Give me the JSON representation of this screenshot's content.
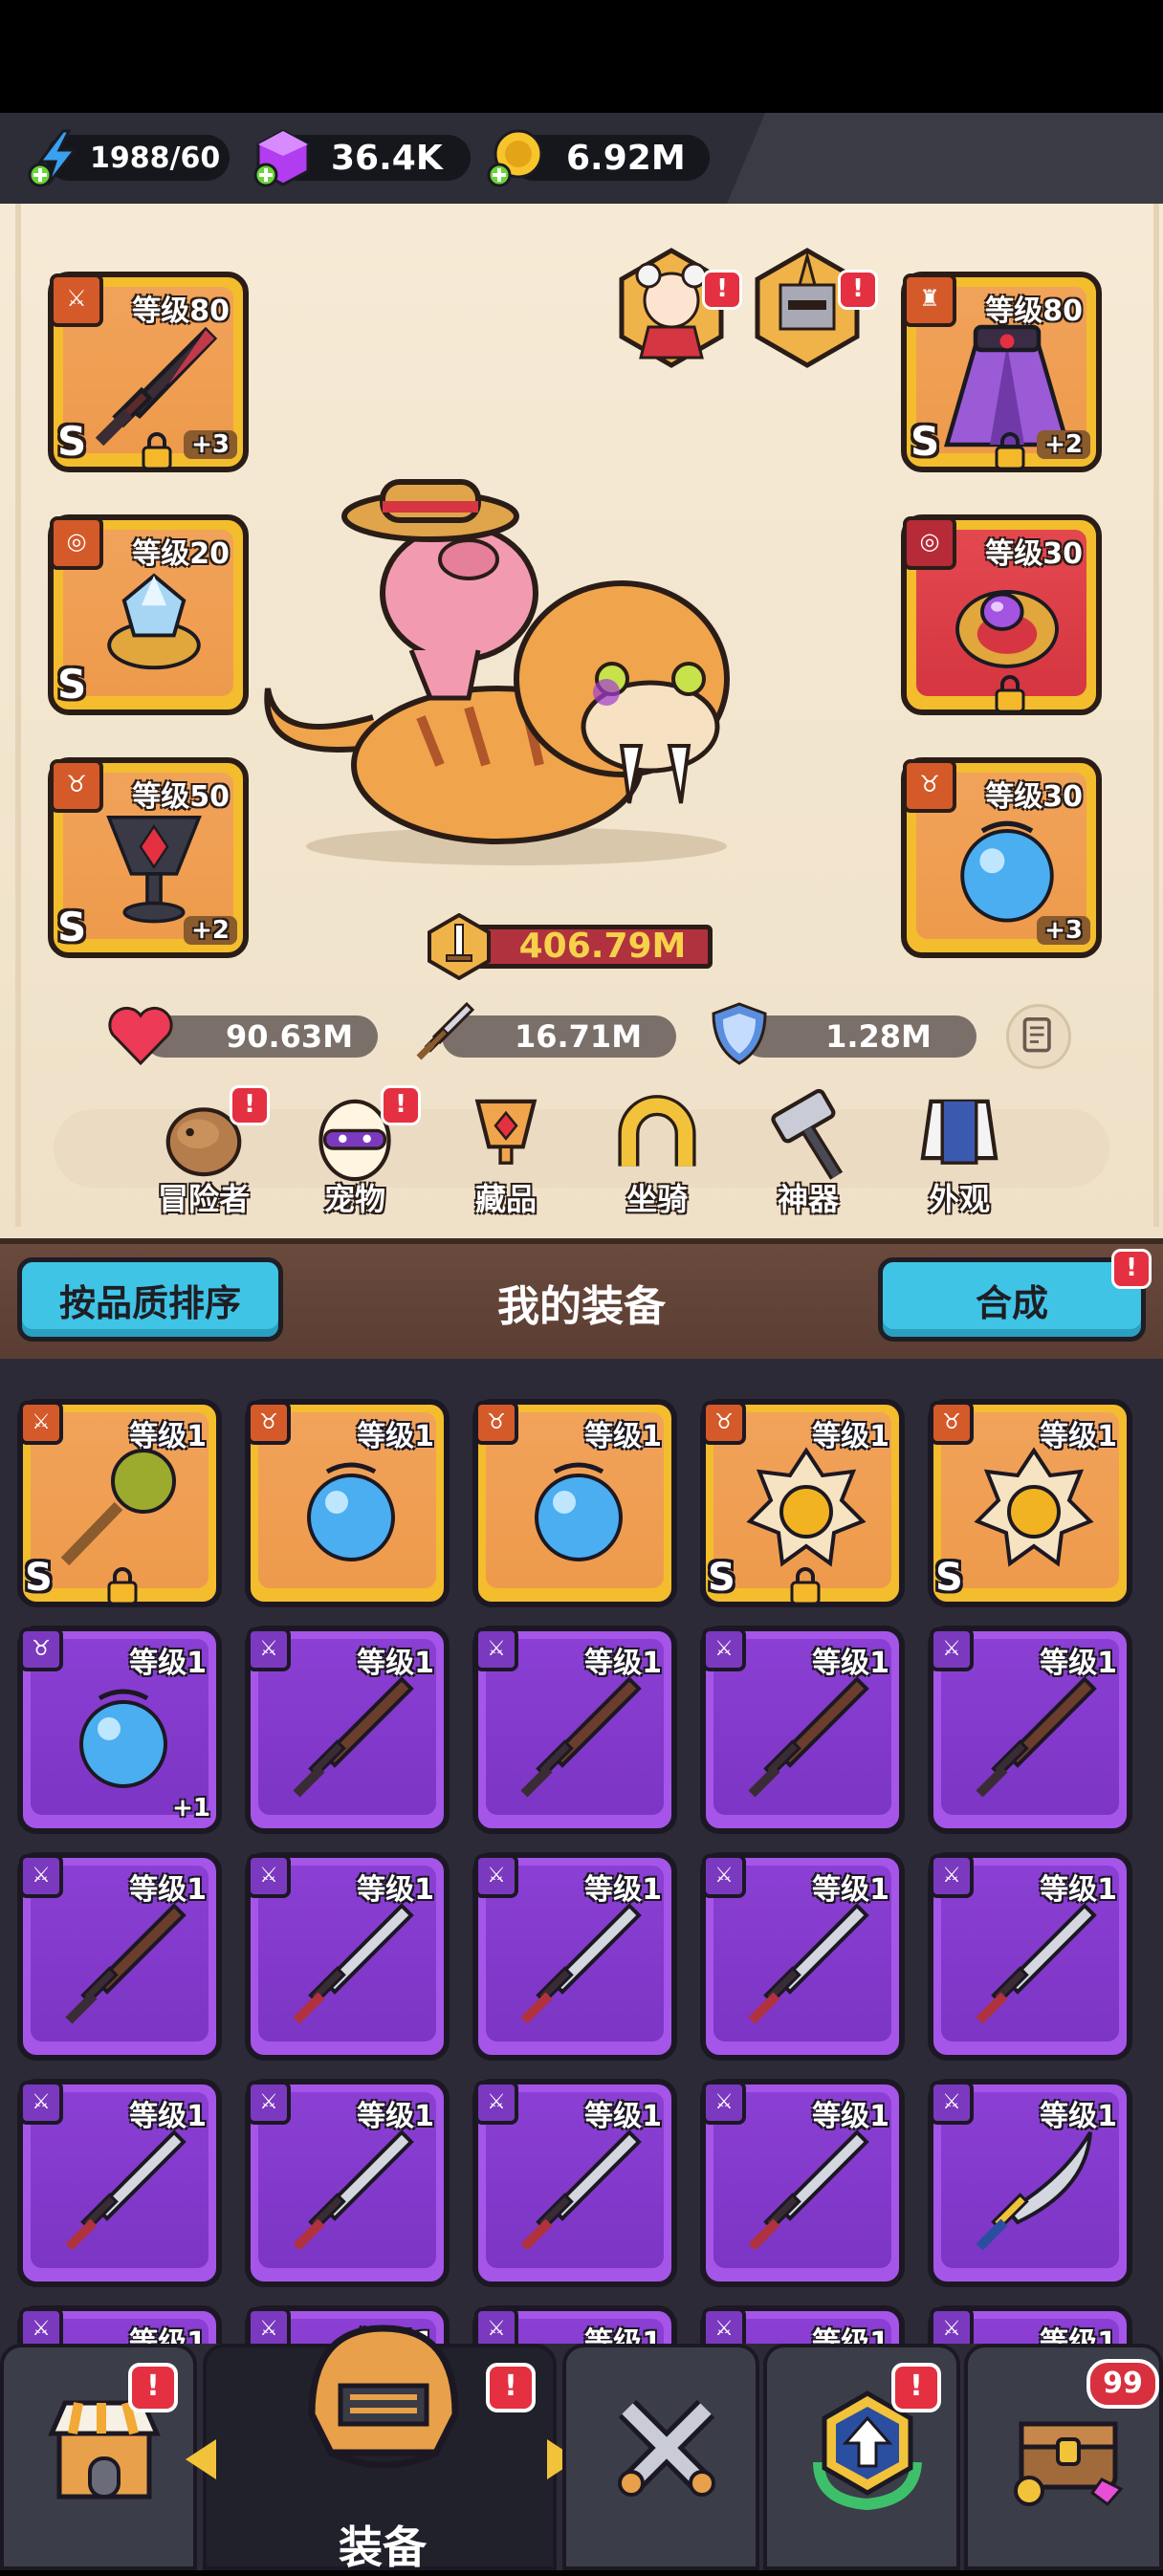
{
  "resources": {
    "energy": "1988/60",
    "gems": "36.4K",
    "gold": "6.92M"
  },
  "equipped": {
    "left": [
      {
        "level": "等级80",
        "plus": "+3",
        "rarity": "S",
        "locked": true,
        "item": "dark-sword"
      },
      {
        "level": "等级20",
        "plus": "",
        "rarity": "S",
        "locked": false,
        "item": "crystal-ring"
      },
      {
        "level": "等级50",
        "plus": "+2",
        "rarity": "S",
        "locked": false,
        "item": "ruby-amulet"
      }
    ],
    "right": [
      {
        "level": "等级80",
        "plus": "+2",
        "rarity": "S",
        "locked": true,
        "item": "purple-cape"
      },
      {
        "level": "等级30",
        "plus": "",
        "rarity": "",
        "locked": true,
        "item": "amethyst-ring"
      },
      {
        "level": "等级30",
        "plus": "+3",
        "rarity": "",
        "locked": false,
        "item": "blue-orb"
      }
    ]
  },
  "power": "406.79M",
  "stats": {
    "hp": "90.63M",
    "attack": "16.71M",
    "defense": "1.28M"
  },
  "char_tabs": [
    {
      "label": "冒险者",
      "alert": "!"
    },
    {
      "label": "宠物",
      "alert": "!"
    },
    {
      "label": "藏品",
      "alert": ""
    },
    {
      "label": "坐骑",
      "alert": ""
    },
    {
      "label": "神器",
      "alert": ""
    },
    {
      "label": "外观",
      "alert": ""
    }
  ],
  "inventory": {
    "sort_label": "按品质排序",
    "title": "我的装备",
    "combine_label": "合成",
    "alert": "!",
    "level_label": "等级1",
    "items": [
      {
        "quality": "gold",
        "type": "weapon",
        "rarity": "S",
        "locked": true,
        "plus": "",
        "art": "mace"
      },
      {
        "quality": "gold",
        "type": "amulet",
        "rarity": "",
        "locked": false,
        "plus": "",
        "art": "orb"
      },
      {
        "quality": "gold",
        "type": "amulet",
        "rarity": "",
        "locked": false,
        "plus": "",
        "art": "orb"
      },
      {
        "quality": "gold",
        "type": "amulet",
        "rarity": "S",
        "locked": true,
        "plus": "",
        "art": "sun-medal"
      },
      {
        "quality": "gold",
        "type": "amulet",
        "rarity": "S",
        "locked": false,
        "plus": "",
        "art": "sun-medal"
      },
      {
        "quality": "purple",
        "type": "amulet",
        "rarity": "",
        "locked": false,
        "plus": "+1",
        "art": "orb"
      },
      {
        "quality": "purple",
        "type": "weapon",
        "rarity": "",
        "locked": false,
        "plus": "",
        "art": "wood-sword"
      },
      {
        "quality": "purple",
        "type": "weapon",
        "rarity": "",
        "locked": false,
        "plus": "",
        "art": "wood-sword"
      },
      {
        "quality": "purple",
        "type": "weapon",
        "rarity": "",
        "locked": false,
        "plus": "",
        "art": "wood-sword"
      },
      {
        "quality": "purple",
        "type": "weapon",
        "rarity": "",
        "locked": false,
        "plus": "",
        "art": "wood-sword"
      },
      {
        "quality": "purple",
        "type": "weapon",
        "rarity": "",
        "locked": false,
        "plus": "",
        "art": "wood-sword"
      },
      {
        "quality": "purple",
        "type": "weapon",
        "rarity": "",
        "locked": false,
        "plus": "",
        "art": "steel-sword"
      },
      {
        "quality": "purple",
        "type": "weapon",
        "rarity": "",
        "locked": false,
        "plus": "",
        "art": "steel-sword"
      },
      {
        "quality": "purple",
        "type": "weapon",
        "rarity": "",
        "locked": false,
        "plus": "",
        "art": "steel-sword"
      },
      {
        "quality": "purple",
        "type": "weapon",
        "rarity": "",
        "locked": false,
        "plus": "",
        "art": "steel-sword"
      },
      {
        "quality": "purple",
        "type": "weapon",
        "rarity": "",
        "locked": false,
        "plus": "",
        "art": "steel-sword"
      },
      {
        "quality": "purple",
        "type": "weapon",
        "rarity": "",
        "locked": false,
        "plus": "",
        "art": "steel-sword"
      },
      {
        "quality": "purple",
        "type": "weapon",
        "rarity": "",
        "locked": false,
        "plus": "",
        "art": "steel-sword"
      },
      {
        "quality": "purple",
        "type": "weapon",
        "rarity": "",
        "locked": false,
        "plus": "",
        "art": "steel-sword"
      },
      {
        "quality": "purple",
        "type": "weapon",
        "rarity": "",
        "locked": false,
        "plus": "",
        "art": "curved-blade"
      },
      {
        "quality": "purple",
        "type": "weapon",
        "rarity": "",
        "locked": false,
        "plus": "",
        "art": "steel-sword"
      },
      {
        "quality": "purple",
        "type": "weapon",
        "rarity": "",
        "locked": false,
        "plus": "",
        "art": "steel-sword"
      },
      {
        "quality": "purple",
        "type": "weapon",
        "rarity": "",
        "locked": false,
        "plus": "",
        "art": "steel-sword"
      },
      {
        "quality": "purple",
        "type": "weapon",
        "rarity": "",
        "locked": false,
        "plus": "",
        "art": "steel-sword"
      },
      {
        "quality": "purple",
        "type": "weapon",
        "rarity": "",
        "locked": false,
        "plus": "",
        "art": "steel-sword"
      }
    ]
  },
  "bottom_nav": {
    "active_label": "装备",
    "shop_alert": "!",
    "equip_alert": "!",
    "upgrade_alert": "!",
    "chest_count": "99"
  },
  "colors": {
    "gold_frame": "#f3bd2d",
    "purple_frame": "#a556e8",
    "accent_button": "#3fc4e6",
    "alert": "#e43040"
  }
}
